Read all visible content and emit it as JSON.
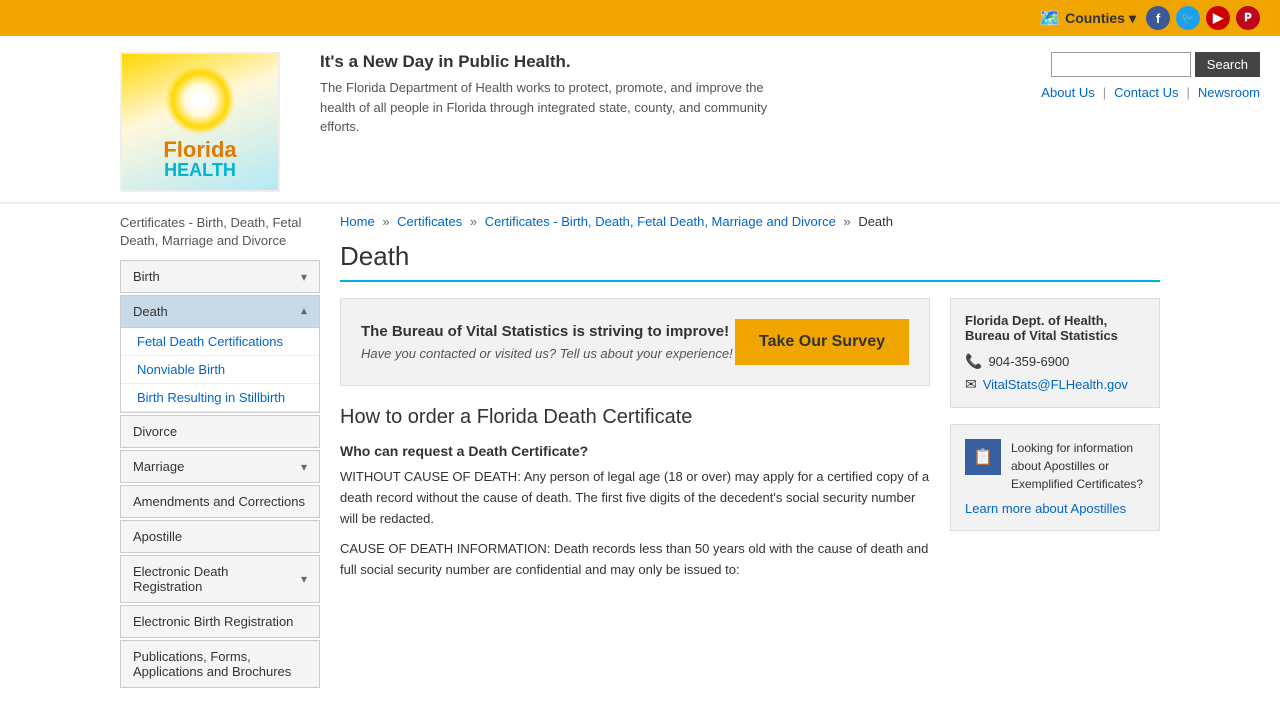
{
  "topbar": {
    "counties_label": "Counties",
    "social": [
      {
        "name": "Facebook",
        "symbol": "f",
        "class": "fb"
      },
      {
        "name": "Twitter",
        "symbol": "t",
        "class": "tw"
      },
      {
        "name": "YouTube",
        "symbol": "▶",
        "class": "yt"
      },
      {
        "name": "Pinterest",
        "symbol": "p",
        "class": "pi"
      }
    ]
  },
  "header": {
    "tagline": "It's a New Day in Public Health.",
    "description": "The Florida Department of Health works to protect, promote, and improve the health of all people in Florida through integrated state, county, and community efforts.",
    "search_placeholder": "",
    "search_label": "Search",
    "nav_links": [
      {
        "label": "About Us",
        "href": "#"
      },
      {
        "label": "Contact Us",
        "href": "#"
      },
      {
        "label": "Newsroom",
        "href": "#"
      }
    ]
  },
  "sidebar": {
    "title": "Certificates - Birth, Death, Fetal Death, Marriage and Divorce",
    "items": [
      {
        "label": "Birth",
        "expandable": true,
        "expanded": false,
        "active": false
      },
      {
        "label": "Death",
        "expandable": true,
        "expanded": true,
        "active": true,
        "subitems": [
          {
            "label": "Fetal Death Certifications"
          },
          {
            "label": "Nonviable Birth"
          },
          {
            "label": "Birth Resulting in Stillbirth"
          }
        ]
      },
      {
        "label": "Divorce",
        "expandable": false,
        "expanded": false
      },
      {
        "label": "Marriage",
        "expandable": true,
        "expanded": false
      },
      {
        "label": "Amendments and Corrections",
        "expandable": false
      },
      {
        "label": "Apostille",
        "expandable": false
      },
      {
        "label": "Electronic Death Registration",
        "expandable": true,
        "expanded": false
      },
      {
        "label": "Electronic Birth Registration",
        "expandable": false
      },
      {
        "label": "Publications, Forms, Applications and Brochures",
        "expandable": false
      }
    ]
  },
  "breadcrumb": {
    "items": [
      {
        "label": "Home",
        "href": "#"
      },
      {
        "label": "Certificates",
        "href": "#"
      },
      {
        "label": "Certificates - Birth, Death, Fetal Death, Marriage and Divorce",
        "href": "#"
      },
      {
        "label": "Death",
        "current": true
      }
    ]
  },
  "page_title": "Death",
  "survey": {
    "heading": "The Bureau of Vital Statistics is striving to improve!",
    "body": "Have you contacted or visited us? Tell us about your experience!",
    "button_label": "Take Our Survey"
  },
  "section_title": "How to order a Florida Death Certificate",
  "sub_title": "Who can request a Death Certificate?",
  "body_paragraphs": [
    "WITHOUT CAUSE OF DEATH: Any person of legal age (18 or over) may apply for a certified copy of a death record without the cause of death. The first five digits of the decedent's social security number will be redacted.",
    "CAUSE OF DEATH INFORMATION:  Death records less than 50 years old with the cause of death and full social security number are confidential and may only be issued to:"
  ],
  "infobox": {
    "title": "Florida Dept. of Health, Bureau of Vital Statistics",
    "phone": "904-359-6900",
    "email": "VitalStats@FLHealth.gov"
  },
  "apostille": {
    "text": "Looking for information about Apostilles or Exemplified Certificates?",
    "link_label": "Learn more about Apostilles"
  }
}
